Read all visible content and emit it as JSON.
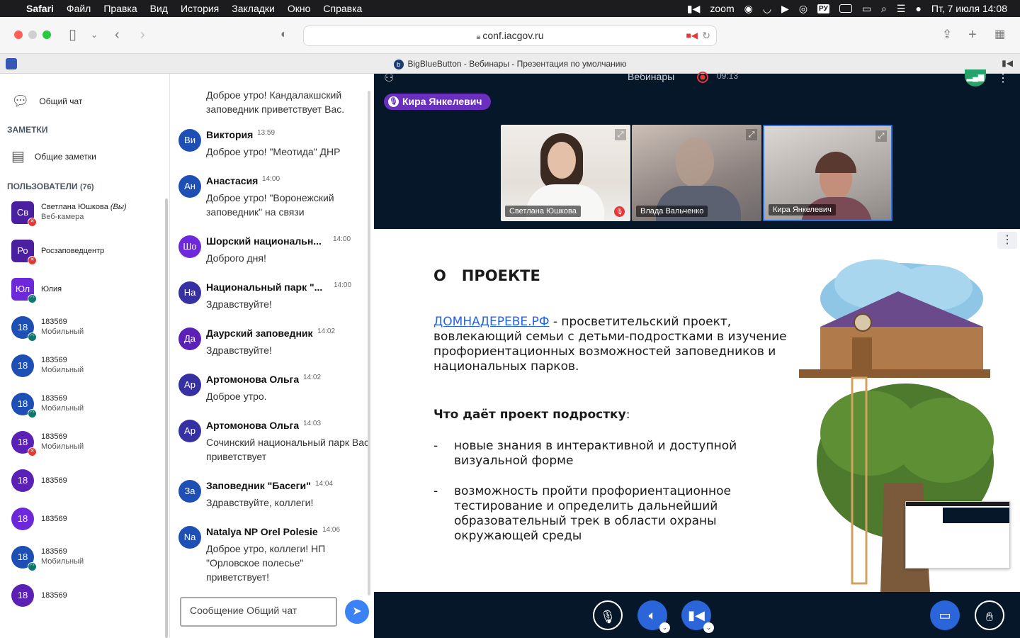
{
  "menubar": {
    "items": [
      "Safari",
      "Файл",
      "Правка",
      "Вид",
      "История",
      "Закладки",
      "Окно",
      "Справка"
    ],
    "zoom": "zoom",
    "lang": "РУ",
    "datetime": "Пт, 7 июля  14:08"
  },
  "toolbar": {
    "url": "conf.iacgov.ru"
  },
  "tab": {
    "title": "BigBlueButton - Вебинары - Презентация по умолчанию",
    "favicon": "b"
  },
  "sidebar": {
    "public_chat": "Общий чат",
    "notes_header": "ЗАМЕТКИ",
    "shared_notes": "Общие заметки",
    "users_header": "ПОЛЬЗОВАТЕЛИ",
    "users_count": "(76)",
    "users": [
      {
        "initials": "Св",
        "name": "Светлана Юшкова",
        "you": "(Вы)",
        "sub": "Веб-камера",
        "color": "#4a1fa0",
        "badge": "#e53935",
        "shape": "square"
      },
      {
        "initials": "Ро",
        "name": "Росзаповедцентр",
        "you": "",
        "sub": "",
        "color": "#4a1fa0",
        "badge": "#e53935",
        "shape": "square"
      },
      {
        "initials": "Юл",
        "name": "Юлия",
        "you": "",
        "sub": "",
        "color": "#6d28d9",
        "badge": "#0f766e",
        "shape": "square"
      },
      {
        "initials": "18",
        "name": "183569",
        "you": "",
        "sub": "Мобильный",
        "color": "#1e4fb5",
        "badge": "#0f766e",
        "shape": "round"
      },
      {
        "initials": "18",
        "name": "183569",
        "you": "",
        "sub": "Мобильный",
        "color": "#1e4fb5",
        "badge": "",
        "shape": "round"
      },
      {
        "initials": "18",
        "name": "183569",
        "you": "",
        "sub": "Мобильный",
        "color": "#1e4fb5",
        "badge": "#0f766e",
        "shape": "round"
      },
      {
        "initials": "18",
        "name": "183569",
        "you": "",
        "sub": "Мобильный",
        "color": "#5b21b6",
        "badge": "#e53935",
        "shape": "round"
      },
      {
        "initials": "18",
        "name": "183569",
        "you": "",
        "sub": "",
        "color": "#5b21b6",
        "badge": "",
        "shape": "round"
      },
      {
        "initials": "18",
        "name": "183569",
        "you": "",
        "sub": "",
        "color": "#6d28d9",
        "badge": "",
        "shape": "round"
      },
      {
        "initials": "18",
        "name": "183569",
        "you": "",
        "sub": "Мобильный",
        "color": "#1e4fb5",
        "badge": "#0f766e",
        "shape": "round"
      },
      {
        "initials": "18",
        "name": "183569",
        "you": "",
        "sub": "",
        "color": "#5b21b6",
        "badge": "",
        "shape": "round"
      }
    ]
  },
  "chat": {
    "partial_top": "Доброе утро! Кандалакшский заповедник приветствует Вас.",
    "messages": [
      {
        "initials": "Ви",
        "name": "Виктория",
        "time": "13:59",
        "text": "Доброе утро! \"Меотида\" ДНР",
        "color": "#1e4fb5"
      },
      {
        "initials": "Ан",
        "name": "Анастасия",
        "time": "14:00",
        "text": "Доброе утро! \"Воронежский заповедник\" на связи",
        "color": "#1e4fb5"
      },
      {
        "initials": "Шо",
        "name": "Шорский национальн...",
        "time": "14:00",
        "text": "Доброго дня!",
        "color": "#6d28d9"
      },
      {
        "initials": "На",
        "name": "Национальный парк \"...",
        "time": "14:00",
        "text": "Здравствуйте!",
        "color": "#3730a3"
      },
      {
        "initials": "Да",
        "name": "Даурский заповедник",
        "time": "14:02",
        "text": "Здравствуйте!",
        "color": "#5b21b6"
      },
      {
        "initials": "Ар",
        "name": "Артомонова Ольга",
        "time": "14:02",
        "text": "Доброе утро.",
        "color": "#3730a3"
      },
      {
        "initials": "Ар",
        "name": "Артомонова Ольга",
        "time": "14:03",
        "text": "Сочинский национальный парк Вас приветствует",
        "color": "#3730a3"
      },
      {
        "initials": "За",
        "name": "Заповедник \"Басеги\"",
        "time": "14:04",
        "text": "Здравствуйте, коллеги!",
        "color": "#1e4fb5"
      },
      {
        "initials": "Na",
        "name": "Natalya NP Orel Polesie",
        "time": "14:06",
        "text": "Доброе утро, коллеги! НП \"Орловское полесье\" приветствует!",
        "color": "#1e4fb5"
      }
    ],
    "input_placeholder": "Сообщение Общий чат"
  },
  "main": {
    "meeting_title": "Вебинары",
    "rec_time": "09:13",
    "talking": "Кира Янкелевич",
    "videos": [
      {
        "name": "Светлана Юшкова",
        "muted": true,
        "bg": "#e9e4de"
      },
      {
        "name": "Влада Вальченко",
        "muted": false,
        "bg": "#9d8f8a"
      },
      {
        "name": "Кира Янкелевич",
        "muted": false,
        "bg": "#b9b3ae"
      }
    ]
  },
  "slide": {
    "heading": "О   ПРОЕКТЕ",
    "link": "ДОМНАДЕРЕВЕ.РФ",
    "intro": " - просветительский проект, вовлекающий семьи с детьми-подростками в изучение профориентационных возможностей заповедников и национальных парков.",
    "subheading": "Что даёт проект подростку",
    "bullets": [
      "новые знания в интерактивной и доступной визуальной форме",
      "возможность пройти профориентационное тестирование и определить дальнейший образовательный трек в области охраны окружающей среды"
    ]
  },
  "icons": [
    "apple-icon",
    "camera-icon",
    "search-icon",
    "share-icon",
    "plus-icon",
    "tabs-icon",
    "mic-icon",
    "speaker-icon",
    "video-icon",
    "screen-share-icon",
    "hand-icon",
    "send-icon",
    "kebab-icon",
    "chat-icon",
    "notes-icon",
    "user-icon",
    "record-icon",
    "signal-icon"
  ]
}
